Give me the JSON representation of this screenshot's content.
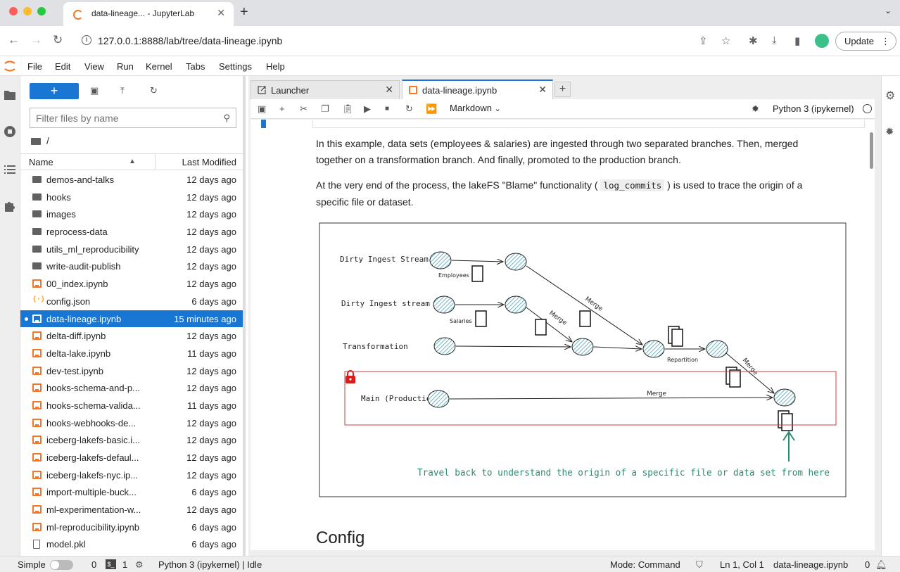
{
  "browser": {
    "tab_title": "data-lineage... - JupyterLab",
    "url": "127.0.0.1:8888/lab/tree/data-lineage.ipynb",
    "update_label": "Update"
  },
  "menu": [
    "File",
    "Edit",
    "View",
    "Run",
    "Kernel",
    "Tabs",
    "Settings",
    "Help"
  ],
  "filebrowser": {
    "new_label": "+",
    "filter_placeholder": "Filter files by name",
    "crumb": "/",
    "col_name": "Name",
    "col_modified": "Last Modified",
    "files": [
      {
        "name": "demos-and-talks",
        "modified": "12 days ago",
        "type": "folder"
      },
      {
        "name": "hooks",
        "modified": "12 days ago",
        "type": "folder"
      },
      {
        "name": "images",
        "modified": "12 days ago",
        "type": "folder"
      },
      {
        "name": "reprocess-data",
        "modified": "12 days ago",
        "type": "folder"
      },
      {
        "name": "utils_ml_reproducibility",
        "modified": "12 days ago",
        "type": "folder"
      },
      {
        "name": "write-audit-publish",
        "modified": "12 days ago",
        "type": "folder"
      },
      {
        "name": "00_index.ipynb",
        "modified": "12 days ago",
        "type": "notebook"
      },
      {
        "name": "config.json",
        "modified": "6 days ago",
        "type": "json"
      },
      {
        "name": "data-lineage.ipynb",
        "modified": "15 minutes ago",
        "type": "notebook"
      },
      {
        "name": "delta-diff.ipynb",
        "modified": "12 days ago",
        "type": "notebook"
      },
      {
        "name": "delta-lake.ipynb",
        "modified": "11 days ago",
        "type": "notebook"
      },
      {
        "name": "dev-test.ipynb",
        "modified": "12 days ago",
        "type": "notebook"
      },
      {
        "name": "hooks-schema-and-p...",
        "modified": "12 days ago",
        "type": "notebook"
      },
      {
        "name": "hooks-schema-valida...",
        "modified": "11 days ago",
        "type": "notebook"
      },
      {
        "name": "hooks-webhooks-de...",
        "modified": "12 days ago",
        "type": "notebook"
      },
      {
        "name": "iceberg-lakefs-basic.i...",
        "modified": "12 days ago",
        "type": "notebook"
      },
      {
        "name": "iceberg-lakefs-defaul...",
        "modified": "12 days ago",
        "type": "notebook"
      },
      {
        "name": "iceberg-lakefs-nyc.ip...",
        "modified": "12 days ago",
        "type": "notebook"
      },
      {
        "name": "import-multiple-buck...",
        "modified": "6 days ago",
        "type": "notebook"
      },
      {
        "name": "ml-experimentation-w...",
        "modified": "12 days ago",
        "type": "notebook"
      },
      {
        "name": "ml-reproducibility.ipynb",
        "modified": "6 days ago",
        "type": "notebook"
      },
      {
        "name": "model.pkl",
        "modified": "6 days ago",
        "type": "file"
      }
    ]
  },
  "tabs": [
    {
      "label": "Launcher"
    },
    {
      "label": "data-lineage.ipynb"
    }
  ],
  "toolbar": {
    "cell_type": "Markdown",
    "kernel": "Python 3 (ipykernel)"
  },
  "notebook": {
    "para1": "In this example, data sets (employees & salaries) are ingested through two separated branches. Then, merged together on a transformation branch. And finally, promoted to the production branch.",
    "para2_before": "At the very end of the process, the lakeFS \"Blame\" functionality (",
    "para2_code": "log_commits",
    "para2_after": ") is used to trace the origin of a specific file or dataset.",
    "heading": "Config"
  },
  "diagram": {
    "stream2": "Dirty Ingest Stream 2",
    "stream1": "Dirty Ingest stream 1",
    "transformation": "Transformation",
    "main": "Main (Production)",
    "employees": "Employees",
    "salaries": "Salaries",
    "merge": "Merge",
    "repartition": "Repartition",
    "travel": "Travel back to understand the origin of a specific file or data set from here"
  },
  "status": {
    "mode_label": "Simple",
    "count_a": "0",
    "count_b": "1",
    "kernel_status": "Python 3 (ipykernel) | Idle",
    "mode": "Mode: Command",
    "position": "Ln 1, Col 1",
    "file": "data-lineage.ipynb",
    "notifications": "0"
  }
}
